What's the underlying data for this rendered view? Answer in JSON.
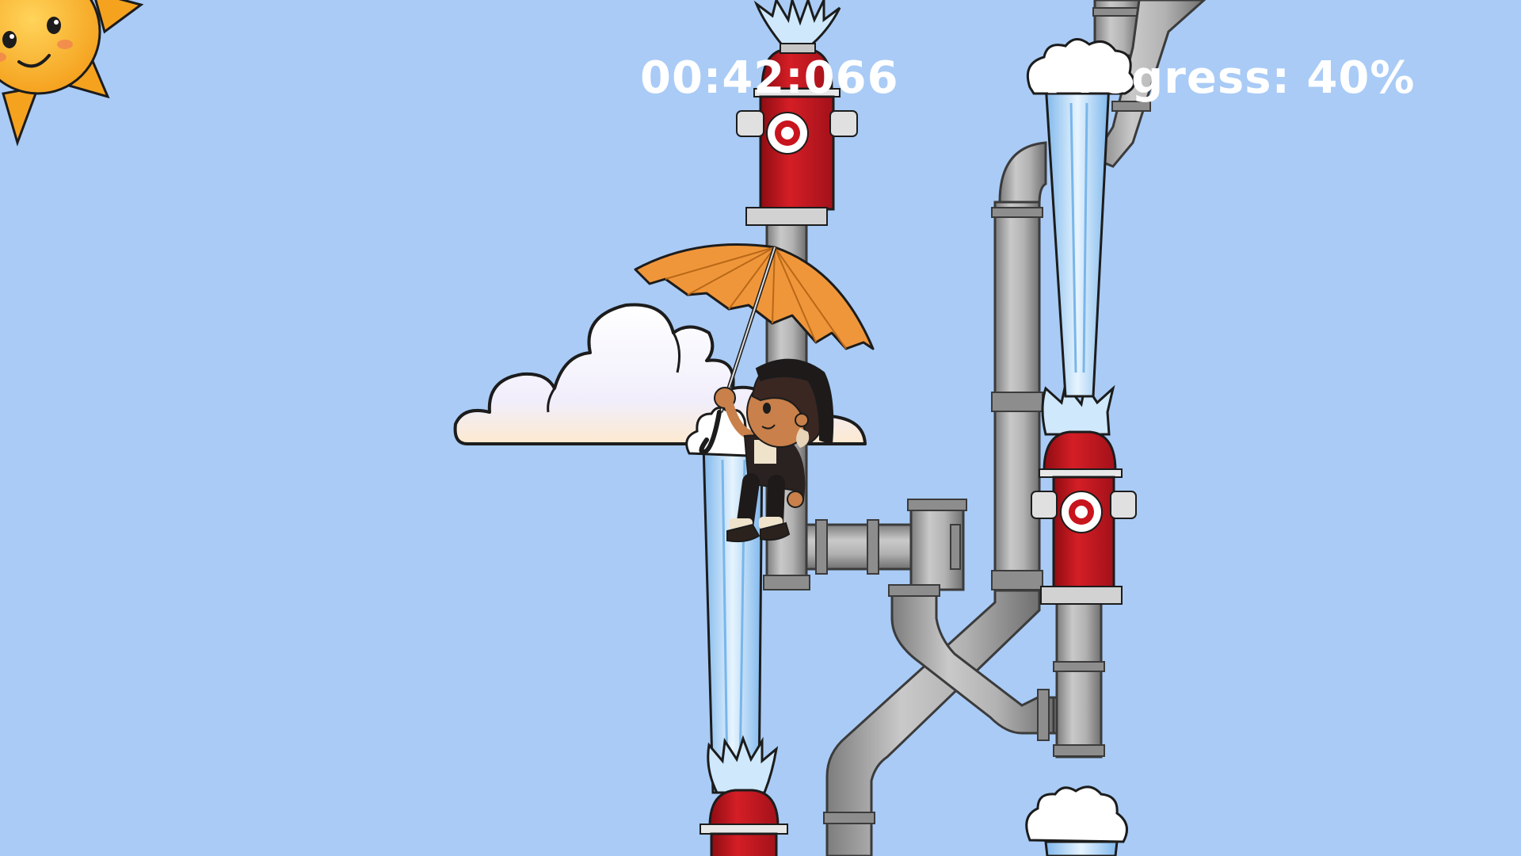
{
  "hud": {
    "timer": "00:42:066",
    "progress_text": "Progress: 40%",
    "progress_value": 0.4
  },
  "icons": {
    "sun": "sun-icon",
    "cloud": "cloud-icon",
    "player": "player-character",
    "umbrella": "umbrella-icon",
    "hydrant": "fire-hydrant",
    "pipe": "pipe",
    "water": "water-jet",
    "foam": "water-foam"
  },
  "colors": {
    "sky": "#a9cbf6",
    "hydrant_red": "#c8141d",
    "umbrella_orange": "#f0963a",
    "pipe_grey": "#a3a3a3",
    "water_blue": "#bfe0f8",
    "sun_yellow": "#f7a928",
    "hud_text": "#ffffff"
  }
}
